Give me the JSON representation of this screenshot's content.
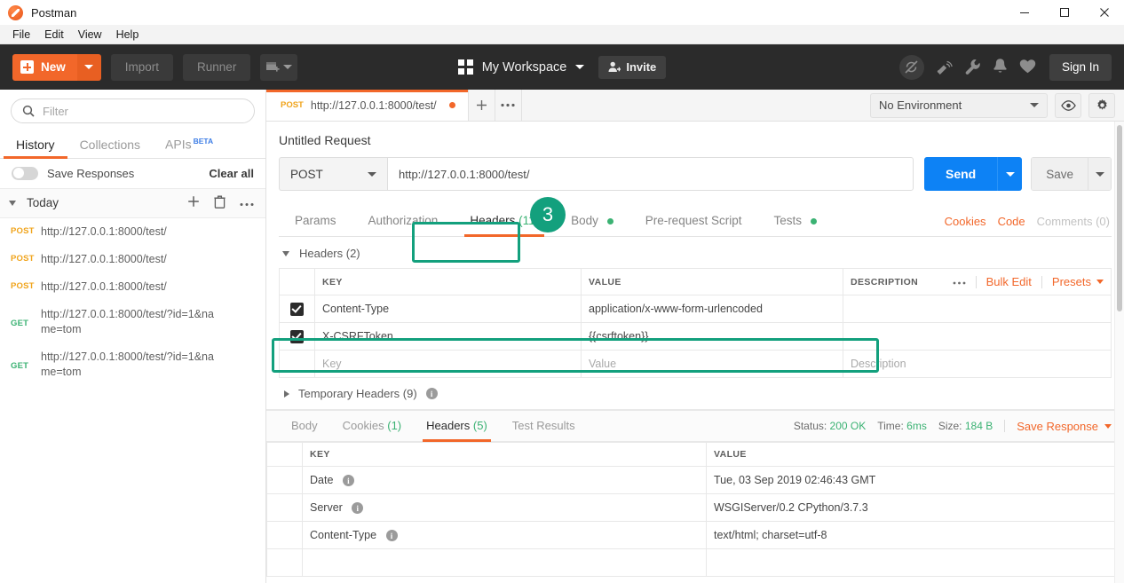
{
  "window": {
    "app_title": "Postman",
    "logo_icon": "postman-logo-icon",
    "minimize_icon": "minimize-icon",
    "maximize_icon": "maximize-icon",
    "close_icon": "close-icon"
  },
  "menubar": {
    "items": [
      "File",
      "Edit",
      "View",
      "Help"
    ]
  },
  "toolbar": {
    "new_label": "New",
    "import_label": "Import",
    "runner_label": "Runner",
    "workspace_label": "My Workspace",
    "invite_label": "Invite",
    "signin_label": "Sign In",
    "icons": [
      "sync-disabled-icon",
      "satellite-icon",
      "wrench-icon",
      "bell-icon",
      "heart-icon"
    ]
  },
  "sidebar": {
    "filter_placeholder": "Filter",
    "tabs": [
      {
        "label": "History",
        "active": true
      },
      {
        "label": "Collections",
        "active": false
      },
      {
        "label": "APIs",
        "badge": "BETA",
        "active": false
      }
    ],
    "save_responses_label": "Save Responses",
    "save_responses_on": false,
    "clear_all_label": "Clear all",
    "group_label": "Today",
    "history": [
      {
        "method": "POST",
        "url": "http://127.0.0.1:8000/test/"
      },
      {
        "method": "POST",
        "url": "http://127.0.0.1:8000/test/"
      },
      {
        "method": "POST",
        "url": "http://127.0.0.1:8000/test/"
      },
      {
        "method": "GET",
        "url": "http://127.0.0.1:8000/test/?id=1&name=tom"
      },
      {
        "method": "GET",
        "url": "http://127.0.0.1:8000/test/?id=1&name=tom"
      }
    ]
  },
  "request_tabstrip": {
    "tab_method": "POST",
    "tab_url": "http://127.0.0.1:8000/test/",
    "unsaved": true,
    "add_tab_icon": "plus-icon",
    "more_tabs_icon": "ellipsis-icon",
    "environment_value": "No Environment",
    "eye_icon": "eye-icon",
    "gear_icon": "gear-icon"
  },
  "request": {
    "title": "Untitled Request",
    "method": "POST",
    "url": "http://127.0.0.1:8000/test/",
    "send_label": "Send",
    "save_label": "Save",
    "tabs": [
      {
        "label": "Params",
        "active": false
      },
      {
        "label": "Authorization",
        "active": false
      },
      {
        "label": "Headers",
        "count": "(11)",
        "active": true
      },
      {
        "label": "Body",
        "dot": true,
        "active": false
      },
      {
        "label": "Pre-request Script",
        "active": false
      },
      {
        "label": "Tests",
        "dot": true,
        "active": false
      }
    ],
    "right_links": [
      {
        "label": "Cookies",
        "muted": false
      },
      {
        "label": "Code",
        "muted": false
      },
      {
        "label": "Comments (0)",
        "muted": true
      }
    ],
    "headers_section_label": "Headers (2)",
    "bulk_edit_label": "Bulk Edit",
    "presets_label": "Presets",
    "more_icon": "ellipsis-icon",
    "table_headers": [
      "KEY",
      "VALUE",
      "DESCRIPTION"
    ],
    "header_rows": [
      {
        "checked": true,
        "key": "Content-Type",
        "value": "application/x-www-form-urlencoded",
        "description": "",
        "variable": false,
        "highlight": false
      },
      {
        "checked": true,
        "key": "X-CSRFToken",
        "value": "{{csrftoken}}",
        "description": "",
        "variable": true,
        "highlight": true
      }
    ],
    "placeholder_row": {
      "key": "Key",
      "value": "Value",
      "description": "Description"
    },
    "temporary_headers_label": "Temporary Headers (9)"
  },
  "response": {
    "tabs": [
      {
        "label": "Body",
        "active": false
      },
      {
        "label": "Cookies",
        "count": "(1)",
        "active": false
      },
      {
        "label": "Headers",
        "count": "(5)",
        "active": true
      },
      {
        "label": "Test Results",
        "active": false
      }
    ],
    "status_label": "Status:",
    "status_value": "200 OK",
    "time_label": "Time:",
    "time_value": "6ms",
    "size_label": "Size:",
    "size_value": "184 B",
    "save_response_label": "Save Response",
    "table_headers": [
      "KEY",
      "VALUE"
    ],
    "rows": [
      {
        "key": "Date",
        "value": "Tue, 03 Sep 2019 02:46:43 GMT"
      },
      {
        "key": "Server",
        "value": "WSGIServer/0.2 CPython/3.7.3"
      },
      {
        "key": "Content-Type",
        "value": "text/html; charset=utf-8"
      }
    ]
  },
  "annotations": {
    "step_badge": "3"
  },
  "colors": {
    "brand_orange": "#f2672a",
    "send_blue": "#0d82f5",
    "annotation_teal": "#13a07d",
    "success_green": "#3bb273",
    "post_amber": "#f0a41c"
  }
}
